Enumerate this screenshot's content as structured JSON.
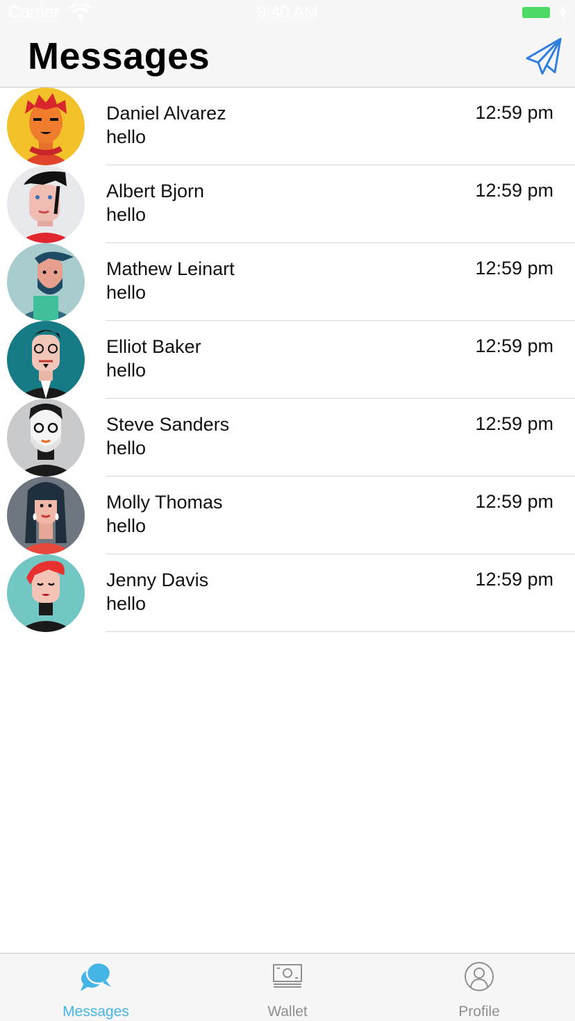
{
  "status_bar": {
    "carrier": "Carrier",
    "time": "9:40 AM",
    "wifi_icon": "wifi-icon",
    "battery_icon": "battery-icon",
    "battery_color": "#4cd964"
  },
  "header": {
    "title": "Messages",
    "compose_icon": "paper-plane-icon",
    "accent_color": "#2f7fe0"
  },
  "messages": [
    {
      "name": "Daniel Alvarez",
      "message": "hello",
      "time": "12:59 pm",
      "avatar_bg": "#f3c22b"
    },
    {
      "name": "Albert Bjorn",
      "message": "hello",
      "time": "12:59 pm",
      "avatar_bg": "#e8e9ec"
    },
    {
      "name": "Mathew Leinart",
      "message": "hello",
      "time": "12:59 pm",
      "avatar_bg": "#a9cdce"
    },
    {
      "name": "Elliot Baker",
      "message": "hello",
      "time": "12:59 pm",
      "avatar_bg": "#177b86"
    },
    {
      "name": "Steve Sanders",
      "message": "hello",
      "time": "12:59 pm",
      "avatar_bg": "#c9cacc"
    },
    {
      "name": "Molly Thomas",
      "message": "hello",
      "time": "12:59 pm",
      "avatar_bg": "#6e7680"
    },
    {
      "name": "Jenny Davis",
      "message": "hello",
      "time": "12:59 pm",
      "avatar_bg": "#72c7c5"
    }
  ],
  "tabbar": {
    "active_color": "#45b5e6",
    "inactive_color": "#8e8e93",
    "tabs": [
      {
        "label": "Messages",
        "icon": "chat-bubbles-icon",
        "active": true
      },
      {
        "label": "Wallet",
        "icon": "banknote-icon",
        "active": false
      },
      {
        "label": "Profile",
        "icon": "person-circle-icon",
        "active": false
      }
    ]
  }
}
